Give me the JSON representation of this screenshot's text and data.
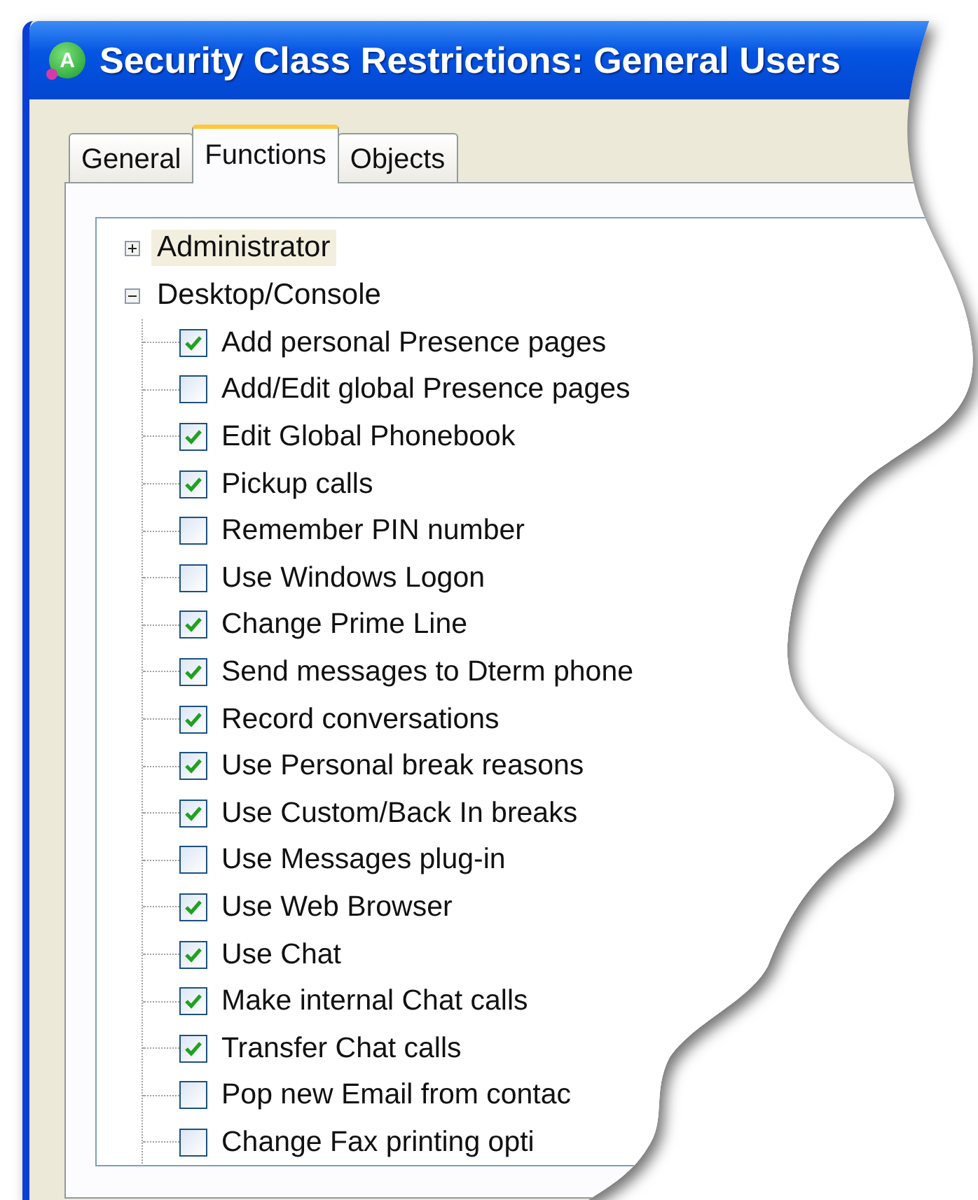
{
  "window": {
    "title": "Security Class Restrictions: General Users",
    "app_icon_letter": "A"
  },
  "tabs": [
    {
      "label": "General",
      "selected": false
    },
    {
      "label": "Functions",
      "selected": true
    },
    {
      "label": "Objects",
      "selected": false
    }
  ],
  "tree": [
    {
      "label": "Administrator",
      "expanded": false,
      "selected": true
    },
    {
      "label": "Desktop/Console",
      "expanded": true,
      "selected": false,
      "children": [
        {
          "label": "Add personal Presence pages",
          "checked": true
        },
        {
          "label": "Add/Edit global Presence pages",
          "checked": false
        },
        {
          "label": "Edit Global Phonebook",
          "checked": true
        },
        {
          "label": "Pickup calls",
          "checked": true
        },
        {
          "label": "Remember PIN number",
          "checked": false
        },
        {
          "label": "Use Windows Logon",
          "checked": false
        },
        {
          "label": "Change Prime Line",
          "checked": true
        },
        {
          "label": "Send messages to Dterm phone",
          "checked": true
        },
        {
          "label": "Record conversations",
          "checked": true
        },
        {
          "label": "Use Personal break reasons",
          "checked": true
        },
        {
          "label": "Use Custom/Back In breaks",
          "checked": true
        },
        {
          "label": "Use Messages plug-in",
          "checked": false
        },
        {
          "label": "Use Web Browser",
          "checked": true
        },
        {
          "label": "Use Chat",
          "checked": true
        },
        {
          "label": "Make internal Chat calls",
          "checked": true
        },
        {
          "label": "Transfer Chat calls",
          "checked": true
        },
        {
          "label": "Pop new Email from contac",
          "checked": false
        },
        {
          "label": "Change Fax printing opti",
          "checked": false
        }
      ]
    }
  ]
}
